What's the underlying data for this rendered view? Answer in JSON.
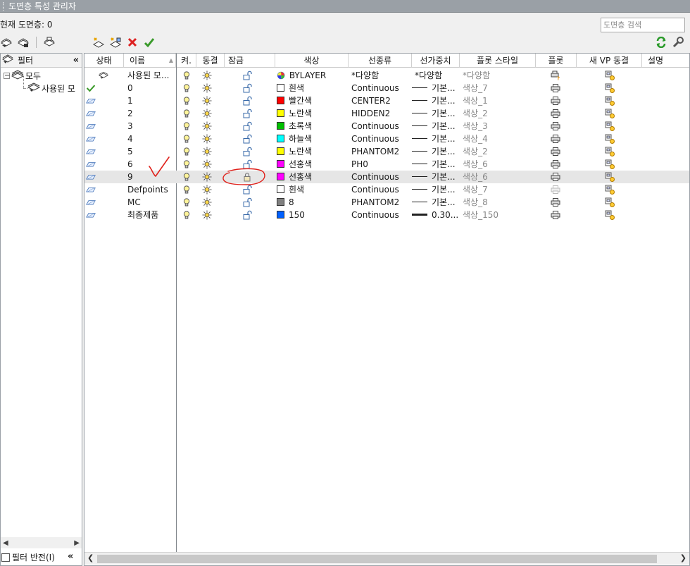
{
  "window": {
    "title": "도면층 특성 관리자"
  },
  "header": {
    "current_layer": "현재 도면층: 0",
    "search_placeholder": "도면층 검색"
  },
  "toolbar_left": [
    "new-property-filter-icon",
    "new-group-filter-icon",
    "layer-states-manager-icon",
    "new-layer-icon",
    "new-layer-vp-frozen-icon",
    "delete-layer-icon",
    "set-current-icon"
  ],
  "toolbar_right": [
    "refresh-icon",
    "settings-icon"
  ],
  "filter_pane": {
    "header": "필터",
    "collapse": "«",
    "tree": [
      {
        "label": "모두",
        "level": 0,
        "expanded": true
      },
      {
        "label": "사용된 모",
        "level": 1
      }
    ],
    "invert_label": "필터 반전(I)"
  },
  "columns": [
    "상태",
    "이름",
    "켜.",
    "동결",
    "잠금",
    "색상",
    "선종류",
    "선가중치",
    "플롯 스타일",
    "플롯",
    "새 VP 동결",
    "설명"
  ],
  "rows": [
    {
      "status": "filter",
      "name": "사용된 모...",
      "locked": false,
      "color_name": "BYLAYER",
      "color_hex": "",
      "linetype": "*다양함",
      "lineweight": "*다양함",
      "plotstyle": "*다양함",
      "plot_state": "varies",
      "selected": false
    },
    {
      "status": "current",
      "name": "0",
      "locked": false,
      "color_name": "흰색",
      "color_hex": "#ffffff",
      "linetype": "Continuous",
      "lineweight": "기본...",
      "plotstyle": "색상_7",
      "plot_state": "on",
      "selected": false
    },
    {
      "status": "layer",
      "name": "1",
      "locked": false,
      "color_name": "빨간색",
      "color_hex": "#ff0000",
      "linetype": "CENTER2",
      "lineweight": "기본...",
      "plotstyle": "색상_1",
      "plot_state": "on",
      "selected": false
    },
    {
      "status": "layer",
      "name": "2",
      "locked": false,
      "color_name": "노란색",
      "color_hex": "#ffff00",
      "linetype": "HIDDEN2",
      "lineweight": "기본...",
      "plotstyle": "색상_2",
      "plot_state": "on",
      "selected": false
    },
    {
      "status": "layer",
      "name": "3",
      "locked": false,
      "color_name": "초록색",
      "color_hex": "#00c000",
      "linetype": "Continuous",
      "lineweight": "기본...",
      "plotstyle": "색상_3",
      "plot_state": "on",
      "selected": false
    },
    {
      "status": "layer",
      "name": "4",
      "locked": false,
      "color_name": "하늘색",
      "color_hex": "#00ffff",
      "linetype": "Continuous",
      "lineweight": "기본...",
      "plotstyle": "색상_4",
      "plot_state": "on",
      "selected": false
    },
    {
      "status": "layer",
      "name": "5",
      "locked": false,
      "color_name": "노란색",
      "color_hex": "#ffff00",
      "linetype": "PHANTOM2",
      "lineweight": "기본...",
      "plotstyle": "색상_2",
      "plot_state": "on",
      "selected": false
    },
    {
      "status": "layer",
      "name": "6",
      "locked": false,
      "color_name": "선홍색",
      "color_hex": "#ff00ff",
      "linetype": "PH0",
      "lineweight": "기본...",
      "plotstyle": "색상_6",
      "plot_state": "on",
      "selected": false
    },
    {
      "status": "layer",
      "name": "9",
      "locked": true,
      "color_name": "선홍색",
      "color_hex": "#ff00ff",
      "linetype": "Continuous",
      "lineweight": "기본...",
      "plotstyle": "색상_6",
      "plot_state": "on",
      "selected": true
    },
    {
      "status": "layer",
      "name": "Defpoints",
      "locked": false,
      "color_name": "흰색",
      "color_hex": "#ffffff",
      "linetype": "Continuous",
      "lineweight": "기본...",
      "plotstyle": "색상_7",
      "plot_state": "off",
      "selected": false
    },
    {
      "status": "layer",
      "name": "MC",
      "locked": false,
      "color_name": "8",
      "color_hex": "#808080",
      "linetype": "PHANTOM2",
      "lineweight": "기본...",
      "plotstyle": "색상_8",
      "plot_state": "on",
      "selected": false
    },
    {
      "status": "layer",
      "name": "최종제품",
      "locked": false,
      "color_name": "150",
      "color_hex": "#0060ff",
      "linetype": "Continuous",
      "lineweight": "0.30...",
      "lineweight_thick": true,
      "plotstyle": "색상_150",
      "plot_state": "on",
      "selected": false
    }
  ],
  "colors": {
    "titlebar": "#9aa0a6",
    "selected_row": "#e6e6e6",
    "annotation": "#e0201a",
    "check": "#3a9a2a"
  }
}
